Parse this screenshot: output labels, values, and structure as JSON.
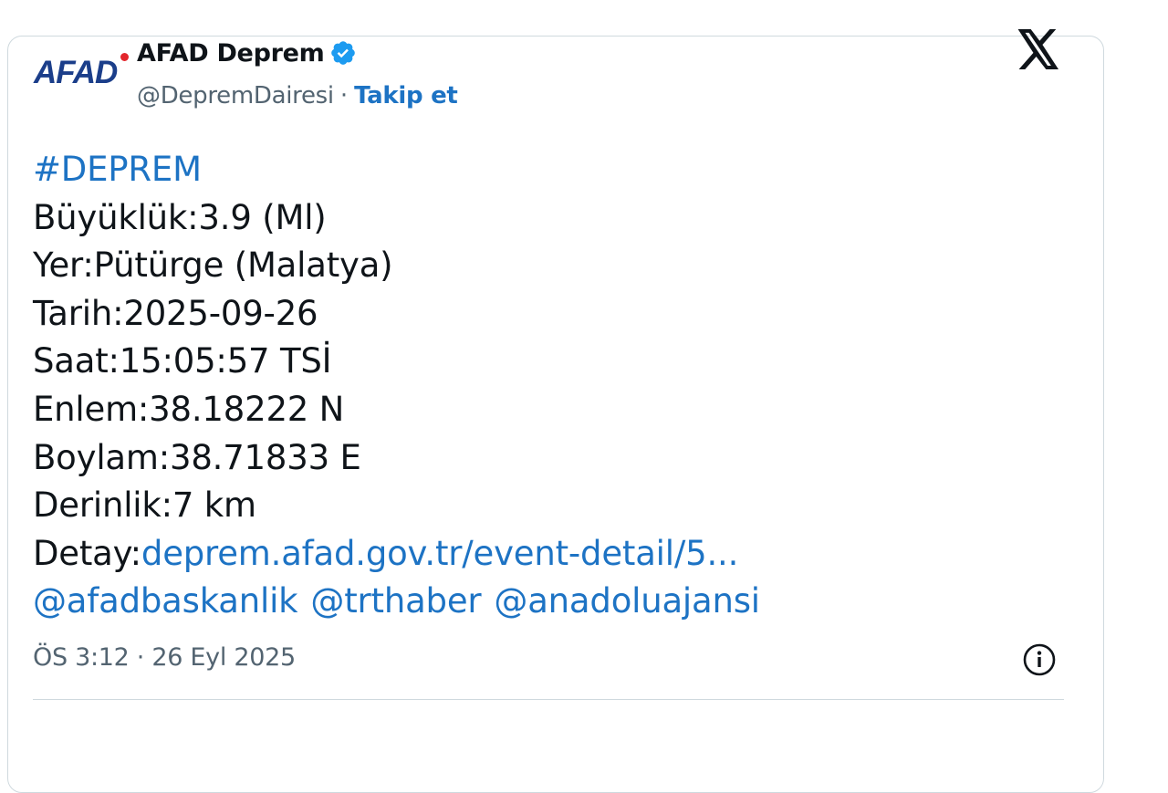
{
  "author": {
    "logo_text": "AFAD",
    "display_name": "AFAD Deprem",
    "handle": "@DepremDairesi",
    "separator": "·",
    "follow_label": "Takip et"
  },
  "tweet": {
    "hashtag": "#DEPREM",
    "magnitude": "Büyüklük:3.9 (Ml)",
    "location": "Yer:Pütürge (Malatya)",
    "date": "Tarih:2025-09-26",
    "time": "Saat:15:05:57 TSİ",
    "latitude": "Enlem:38.18222 N",
    "longitude": "Boylam:38.71833 E",
    "depth": "Derinlik:7 km",
    "detail_prefix": "Detay:",
    "detail_link": "deprem.afad.gov.tr/event-detail/5...",
    "mentions": [
      "@afadbaskanlik",
      "@trthaber",
      "@anadoluajansi"
    ]
  },
  "timestamp": "ÖS 3:12 · 26 Eyl 2025",
  "icons": {
    "verified": "verified-badge-icon",
    "platform": "x-logo-icon",
    "info": "info-icon"
  },
  "colors": {
    "link": "#1d73c4",
    "verified": "#1d9bf0",
    "logo": "#1b3e8a",
    "logo_dot": "#e3262c",
    "text": "#0f1419",
    "muted": "#536471"
  }
}
